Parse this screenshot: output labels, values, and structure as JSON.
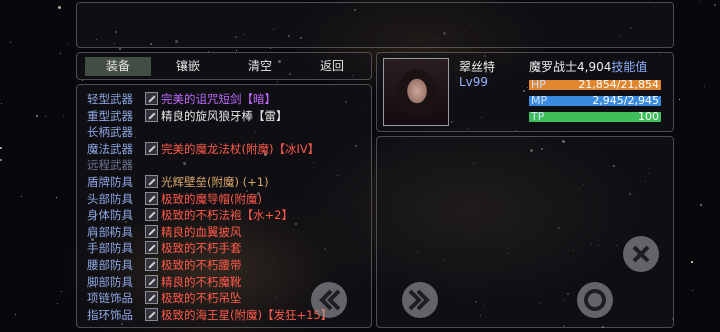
{
  "tabs": [
    "装备",
    "镶嵌",
    "清空",
    "返回"
  ],
  "slots": [
    {
      "label": "轻型武器",
      "item": "完美的诅咒短剑【暗】",
      "color": "#c06bff",
      "dim": false,
      "icon": "sword-icon"
    },
    {
      "label": "重型武器",
      "item": "精良的旋风狼牙棒【雷】",
      "color": "#e8e8e8",
      "dim": false,
      "icon": "mace-icon"
    },
    {
      "label": "长柄武器",
      "item": "",
      "color": "#e8e8e8",
      "dim": false,
      "icon": ""
    },
    {
      "label": "魔法武器",
      "item": "完美的魔龙法杖(附魔)【冰IV】",
      "color": "#ff5a4a",
      "dim": false,
      "icon": "staff-icon"
    },
    {
      "label": "远程武器",
      "item": "",
      "color": "#e8e8e8",
      "dim": true,
      "icon": ""
    },
    {
      "label": "盾牌防具",
      "item": "光辉壁垒(附魔) (+1)",
      "color": "#d9a66a",
      "dim": false,
      "icon": "shield-icon"
    },
    {
      "label": "头部防具",
      "item": "极致的魔导帽(附魔)",
      "color": "#ff5a4a",
      "dim": false,
      "icon": "hat-icon"
    },
    {
      "label": "身体防具",
      "item": "极致的不朽法袍【水+2】",
      "color": "#ff5a4a",
      "dim": false,
      "icon": "robe-icon"
    },
    {
      "label": "肩部防具",
      "item": "精良的血翼披风",
      "color": "#ff5a4a",
      "dim": false,
      "icon": "cape-icon"
    },
    {
      "label": "手部防具",
      "item": "极致的不朽手套",
      "color": "#ff5a4a",
      "dim": false,
      "icon": "gloves-icon"
    },
    {
      "label": "腰部防具",
      "item": "极致的不朽腰带",
      "color": "#ff5a4a",
      "dim": false,
      "icon": "belt-icon"
    },
    {
      "label": "脚部防具",
      "item": "精良的不朽魔靴",
      "color": "#ff5a4a",
      "dim": false,
      "icon": "boots-icon"
    },
    {
      "label": "项链饰品",
      "item": "极致的不朽吊坠",
      "color": "#ff5a4a",
      "dim": false,
      "icon": "necklace-icon"
    },
    {
      "label": "指环饰品",
      "item": "极致的海王星(附魔)【发狂+15】",
      "color": "#ff5a4a",
      "dim": false,
      "icon": "ring-icon"
    }
  ],
  "character": {
    "name": "翠丝特",
    "level": "Lv99",
    "class_label": "魔罗战士",
    "skill_points": "4,904",
    "skill_label": "技能值",
    "hp_label": "HP",
    "hp_value": "21,854/21,854",
    "hp_fraction": 1.0,
    "mp_label": "MP",
    "mp_value": "2,945/2,945",
    "mp_fraction": 1.0,
    "tp_label": "TP",
    "tp_value": "100",
    "tp_fraction": 1.0
  },
  "colors": {
    "hp": "#e0862e",
    "mp": "#3a8be0",
    "tp": "#3fbf5a",
    "skill_label": "#8fb2ff"
  },
  "controls": [
    "previous-icon",
    "next-icon",
    "close-icon",
    "confirm-icon"
  ]
}
